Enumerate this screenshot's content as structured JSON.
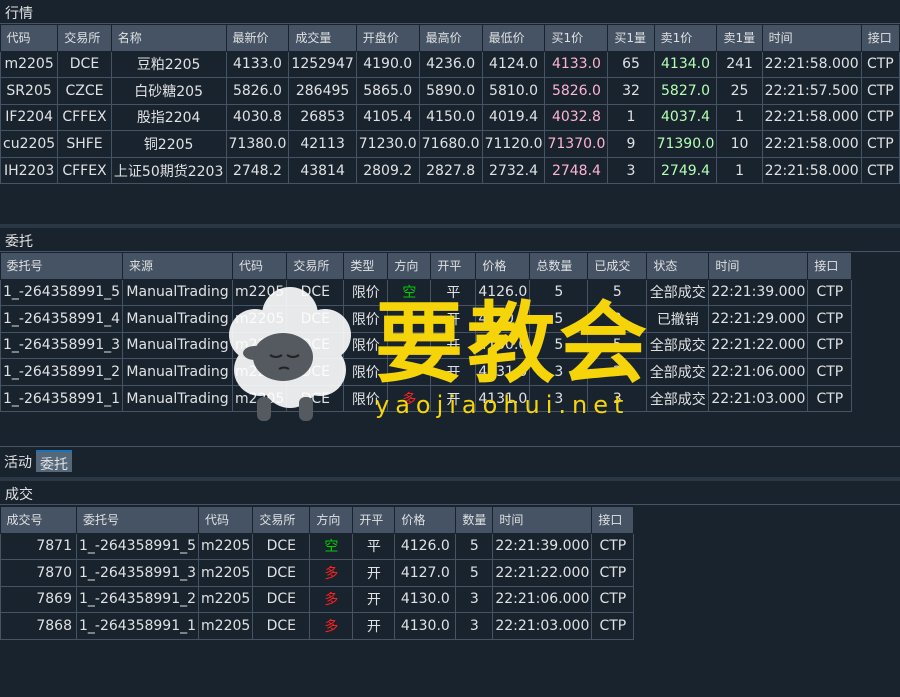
{
  "market": {
    "title": "行情",
    "headers": [
      "代码",
      "交易所",
      "名称",
      "最新价",
      "成交量",
      "开盘价",
      "最高价",
      "最低价",
      "买1价",
      "买1量",
      "卖1价",
      "卖1量",
      "时间",
      "接口"
    ],
    "rows": [
      [
        "m2205",
        "DCE",
        "豆粕2205",
        "4133.0",
        "1252947",
        "4190.0",
        "4236.0",
        "4124.0",
        "4133.0",
        "65",
        "4134.0",
        "241",
        "22:21:58.000",
        "CTP"
      ],
      [
        "SR205",
        "CZCE",
        "白砂糖205",
        "5826.0",
        "286495",
        "5865.0",
        "5890.0",
        "5810.0",
        "5826.0",
        "32",
        "5827.0",
        "25",
        "22:21:57.500",
        "CTP"
      ],
      [
        "IF2204",
        "CFFEX",
        "股指2204",
        "4030.8",
        "26853",
        "4105.4",
        "4150.0",
        "4019.4",
        "4032.8",
        "1",
        "4037.4",
        "1",
        "22:21:58.000",
        "CTP"
      ],
      [
        "cu2205",
        "SHFE",
        "铜2205",
        "71380.0",
        "42113",
        "71230.0",
        "71680.0",
        "71120.0",
        "71370.0",
        "9",
        "71390.0",
        "10",
        "22:21:58.000",
        "CTP"
      ],
      [
        "IH2203",
        "CFFEX",
        "上证50期货2203",
        "2748.2",
        "43814",
        "2809.2",
        "2827.8",
        "2732.4",
        "2748.4",
        "3",
        "2749.4",
        "1",
        "22:21:58.000",
        "CTP"
      ]
    ]
  },
  "orders": {
    "title": "委托",
    "headers": [
      "委托号",
      "来源",
      "代码",
      "交易所",
      "类型",
      "方向",
      "开平",
      "价格",
      "总数量",
      "已成交",
      "状态",
      "时间",
      "接口"
    ],
    "rows": [
      [
        "1_-264358991_5",
        "ManualTrading",
        "m2205",
        "DCE",
        "限价",
        "空",
        "平",
        "4126.0",
        "5",
        "5",
        "全部成交",
        "22:21:39.000",
        "CTP"
      ],
      [
        "1_-264358991_4",
        "ManualTrading",
        "m2205",
        "DCE",
        "限价",
        "多",
        "开",
        "4120.0",
        "5",
        "0",
        "已撤销",
        "22:21:29.000",
        "CTP"
      ],
      [
        "1_-264358991_3",
        "ManualTrading",
        "m2205",
        "DCE",
        "限价",
        "多",
        "开",
        "4130.0",
        "5",
        "5",
        "全部成交",
        "22:21:22.000",
        "CTP"
      ],
      [
        "1_-264358991_2",
        "ManualTrading",
        "m2205",
        "DCE",
        "限价",
        "多",
        "开",
        "4131.0",
        "3",
        "3",
        "全部成交",
        "22:21:06.000",
        "CTP"
      ],
      [
        "1_-264358991_1",
        "ManualTrading",
        "m2205",
        "DCE",
        "限价",
        "多",
        "开",
        "4131.0",
        "3",
        "3",
        "全部成交",
        "22:21:03.000",
        "CTP"
      ]
    ]
  },
  "tabs": [
    "活动",
    "委托"
  ],
  "trades": {
    "title": "成交",
    "headers": [
      "成交号",
      "委托号",
      "代码",
      "交易所",
      "方向",
      "开平",
      "价格",
      "数量",
      "时间",
      "接口"
    ],
    "rows": [
      [
        "7871",
        "1_-264358991_5",
        "m2205",
        "DCE",
        "空",
        "平",
        "4126.0",
        "5",
        "22:21:39.000",
        "CTP"
      ],
      [
        "7870",
        "1_-264358991_3",
        "m2205",
        "DCE",
        "多",
        "开",
        "4127.0",
        "5",
        "22:21:22.000",
        "CTP"
      ],
      [
        "7869",
        "1_-264358991_2",
        "m2205",
        "DCE",
        "多",
        "开",
        "4130.0",
        "3",
        "22:21:06.000",
        "CTP"
      ],
      [
        "7868",
        "1_-264358991_1",
        "m2205",
        "DCE",
        "多",
        "开",
        "4130.0",
        "3",
        "22:21:03.000",
        "CTP"
      ]
    ]
  },
  "watermark": {
    "text": "要教会",
    "url": "yaojiaohui.net"
  },
  "colors": {
    "background": "#19232d",
    "header": "#455364",
    "bid": "#ffb4d2",
    "ask": "#b4ffb4",
    "direction_short": "#00cc00",
    "direction_long": "#ff2020",
    "watermark": "#f5d50a"
  }
}
